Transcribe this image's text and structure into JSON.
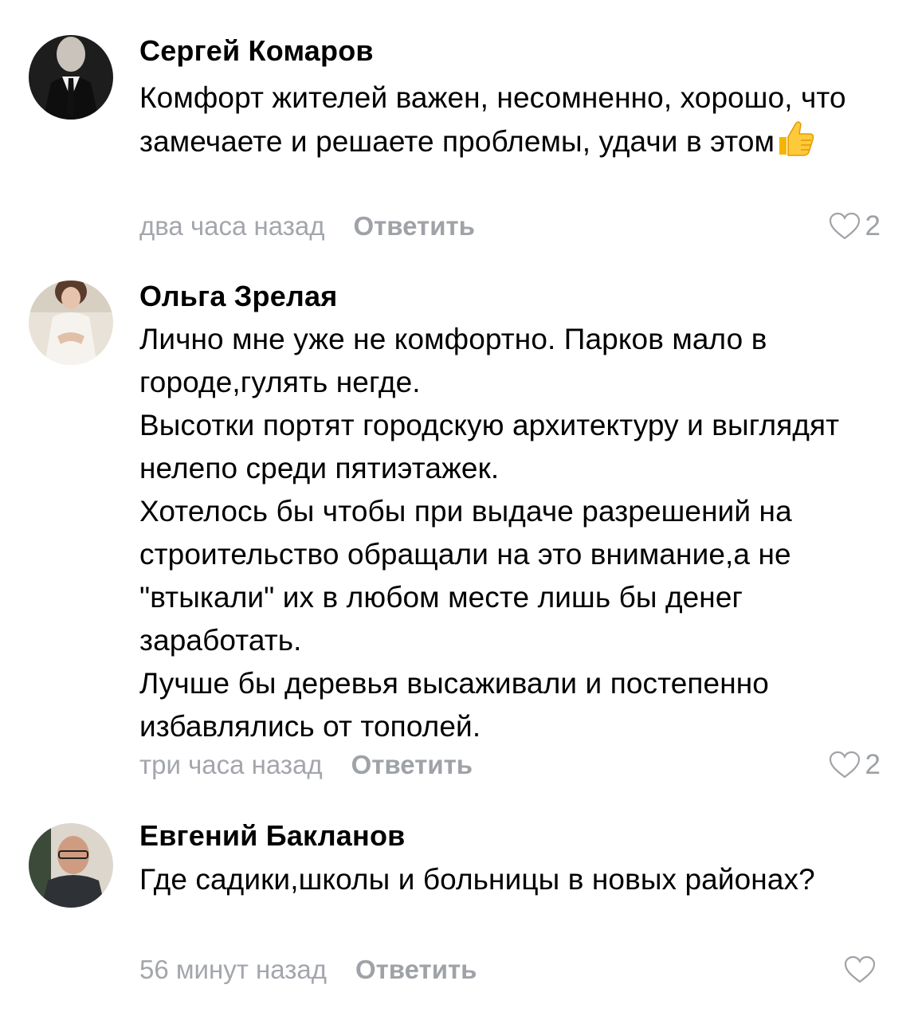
{
  "comments": [
    {
      "author": "Сергей Комаров",
      "text": "Комфорт жителей важен, несомненно, хорошо, что замечаете и решаете проблемы, удачи в этом",
      "emoji": "thumbs-up-icon",
      "time": "два часа назад",
      "reply_label": "Ответить",
      "likes": "2"
    },
    {
      "author": "Ольга Зрелая",
      "text": "Лично мне уже не комфортно. Парков мало в городе,гулять негде.\nВысотки портят городскую архитектуру и выглядят нелепо среди пятиэтажек.\nХотелось бы чтобы при выдаче разрешений на строительство обращали на это внимание,а не \"втыкали\" их в любом месте лишь бы денег заработать.\nЛучше бы деревья высаживали и постепенно избавлялись от тополей.",
      "time": "три часа назад",
      "reply_label": "Ответить",
      "likes": "2"
    },
    {
      "author": "Евгений Бакланов",
      "text": "Где садики,школы и больницы в новых районах?",
      "time": "56 минут назад",
      "reply_label": "Ответить",
      "likes": ""
    }
  ],
  "colors": {
    "text": "#000000",
    "meta": "#a3a6ab",
    "heart": "#a0a3a8"
  }
}
